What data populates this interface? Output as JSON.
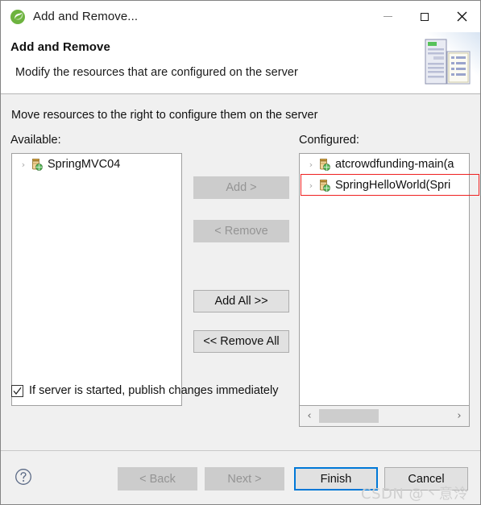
{
  "window": {
    "title": "Add and Remove...",
    "title_icon": "spring-leaf-icon",
    "minimize_label": "Minimize",
    "maximize_label": "Maximize",
    "close_label": "Close",
    "close_glyph": "✕"
  },
  "header": {
    "title": "Add and Remove",
    "description": "Modify the resources that are configured on the server",
    "banner_icon": "server-and-document-icon"
  },
  "body": {
    "instruction": "Move resources to the right to configure them on the server",
    "available_label": "Available:",
    "configured_label": "Configured:",
    "available_items": [
      {
        "twisty": "›",
        "icon": "jar-module-icon",
        "label": "SpringMVC04"
      }
    ],
    "configured_items": [
      {
        "twisty": "›",
        "icon": "jar-module-icon",
        "label": "atcrowdfunding-main(a"
      },
      {
        "twisty": "›",
        "icon": "jar-module-icon",
        "label": "SpringHelloWorld(Spri"
      }
    ],
    "highlight_color": "#ef2020",
    "scrollbar": {
      "left_arrow": "‹",
      "right_arrow": "›"
    },
    "buttons": {
      "add": "Add >",
      "remove": "< Remove",
      "add_all": "Add All >>",
      "remove_all": "<< Remove All"
    },
    "checkbox": {
      "label": "If server is started, publish changes immediately",
      "checked": true
    }
  },
  "footer": {
    "help_icon": "help-question-icon",
    "back": "< Back",
    "next": "Next >",
    "finish": "Finish",
    "cancel": "Cancel",
    "focus_color": "#0078d7"
  },
  "watermark": "CSDN @丶意泠"
}
